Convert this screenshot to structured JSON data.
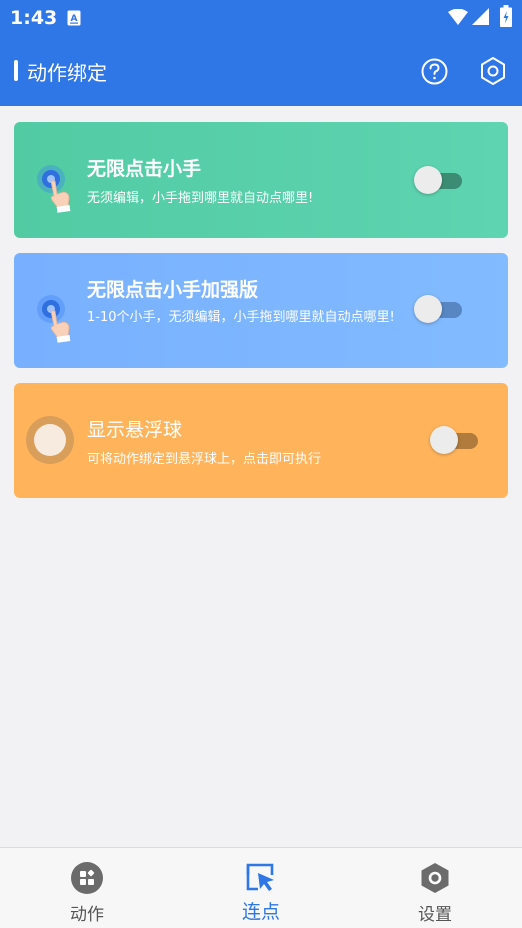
{
  "status_bar": {
    "time": "1:43",
    "notification_icon": "a-box-icon",
    "wifi_icon": "wifi-icon",
    "signal_icon": "signal-icon",
    "battery_icon": "battery-icon"
  },
  "app_bar": {
    "title": "动作绑定",
    "background": "#2f76e6",
    "help_icon": "help-circle-icon",
    "settings_icon": "hexagon-settings-icon"
  },
  "cards": [
    {
      "title": "无限点击小手",
      "desc": "无须编辑，小手拖到哪里就自动点哪里!",
      "icon": "tap-hand-icon",
      "color": "#52cba3",
      "toggle_on": false
    },
    {
      "title": "无限点击小手加强版",
      "desc": "1-10个小手，无须编辑，小手拖到哪里就自动点哪里!",
      "icon": "tap-hand-icon",
      "color": "#78b0ff",
      "toggle_on": false
    },
    {
      "title": "显示悬浮球",
      "desc": "可将动作绑定到悬浮球上，点击即可执行",
      "icon": "floating-ball-icon",
      "color": "#ffb45c",
      "toggle_on": false
    }
  ],
  "bottom_nav": {
    "items": [
      {
        "label": "动作",
        "icon": "grid-circle-icon",
        "active": false
      },
      {
        "label": "连点",
        "icon": "cursor-select-icon",
        "active": true
      },
      {
        "label": "设置",
        "icon": "hexagon-gear-icon",
        "active": false
      }
    ],
    "active_color": "#2f76e6"
  }
}
